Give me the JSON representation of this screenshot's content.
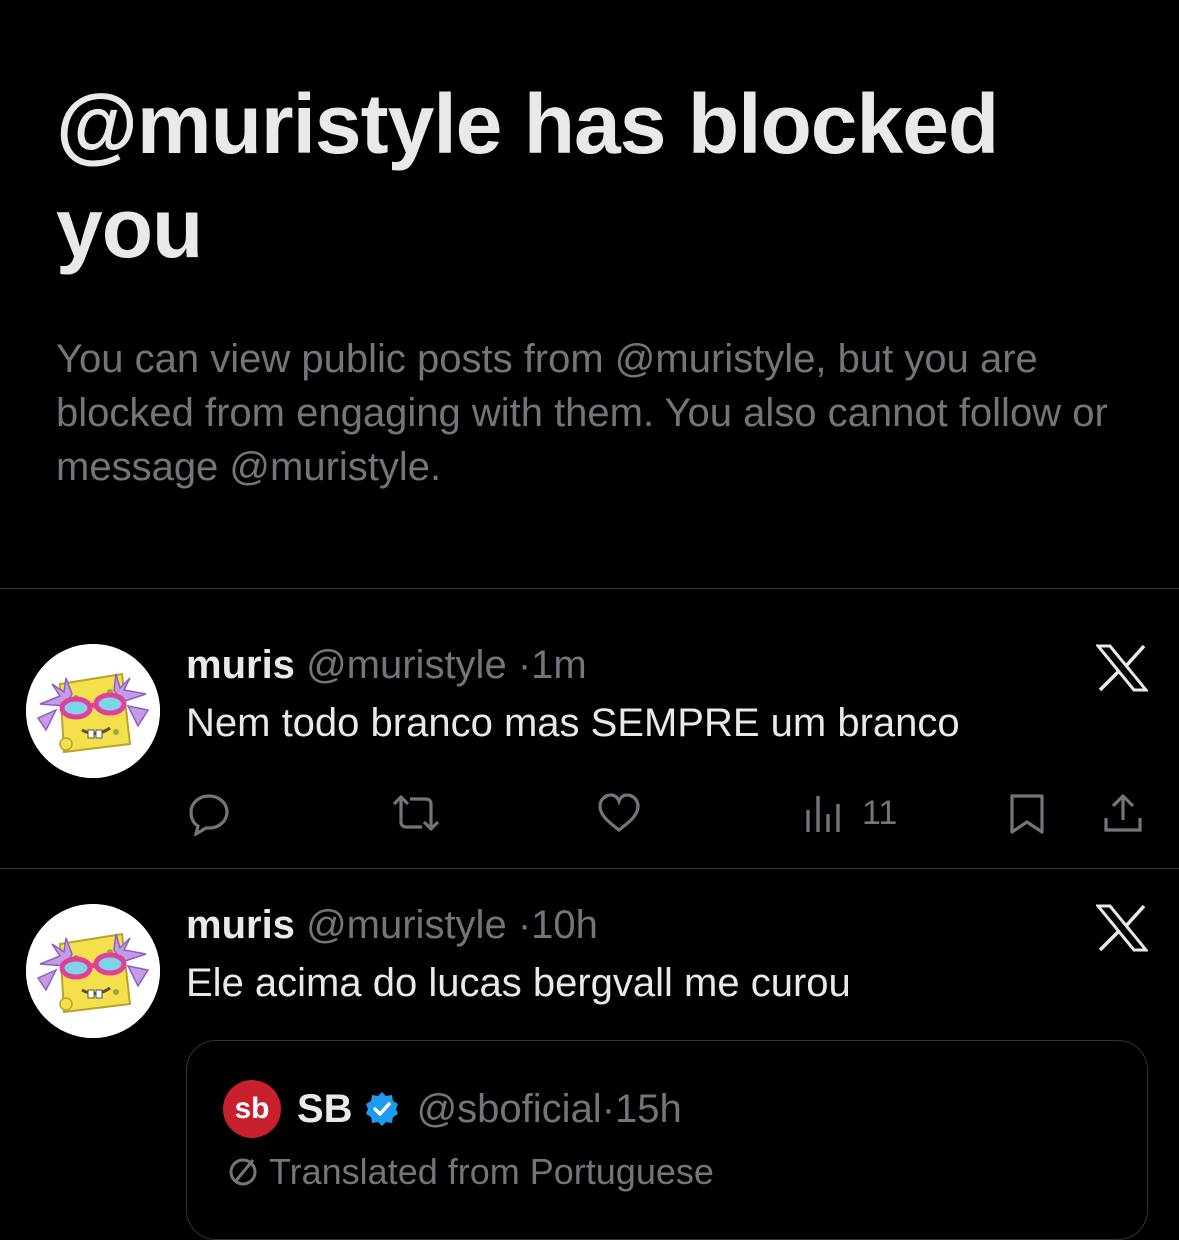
{
  "blocked_notice": {
    "title": "@muristyle has blocked you",
    "description": "You can view public posts from @muristyle, but you are blocked from engaging with them. You also cannot follow or message @muristyle."
  },
  "posts": [
    {
      "name": "muris",
      "handle": "@muristyle",
      "separator": "·",
      "time": "1m",
      "text": "Nem todo branco mas SEMPRE um branco",
      "views": "11"
    },
    {
      "name": "muris",
      "handle": "@muristyle",
      "separator": "·",
      "time": "10h",
      "text": "Ele acima do lucas bergvall me curou",
      "quote": {
        "logo_text": "sb",
        "name": "SB",
        "handle": "@sboficial",
        "separator": "·",
        "time": "15h",
        "translated_label": "Translated from Portuguese"
      }
    }
  ],
  "icons": {
    "reply": "reply-icon",
    "repost": "repost-icon",
    "like": "like-icon",
    "views": "views-icon",
    "bookmark": "bookmark-icon",
    "share": "share-icon",
    "x_logo": "x-logo-icon",
    "verified": "verified-badge-icon",
    "translate": "translate-icon"
  },
  "colors": {
    "background": "#000000",
    "text_primary": "#e7e9ea",
    "text_secondary": "#71767b",
    "divider": "#2f3336",
    "verified_blue": "#1d9bf0",
    "sb_red": "#c8202f"
  }
}
